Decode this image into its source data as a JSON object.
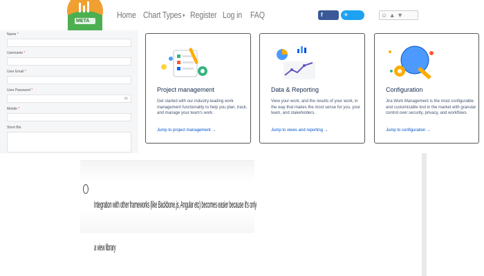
{
  "navbar": {
    "logo_text": "META",
    "links": [
      {
        "label": "Home"
      },
      {
        "label": "Chart Types"
      },
      {
        "label": "Register"
      },
      {
        "label": "Log in"
      },
      {
        "label": "FAQ"
      }
    ],
    "share_facebook": "Share",
    "share_twitter": "Tweet"
  },
  "form": {
    "fields": [
      {
        "label": "Name",
        "required": "*"
      },
      {
        "label": "Username",
        "required": "*"
      },
      {
        "label": "User Email",
        "required": "*"
      },
      {
        "label": "User Password",
        "required": "*",
        "suffix": "ab"
      },
      {
        "label": "Mobile",
        "required": "*"
      },
      {
        "label": "Short Bio",
        "required": ""
      }
    ]
  },
  "cards": [
    {
      "title": "Project management",
      "description": "Get started with our industry-leading work management functionality to help you plan, track, and manage your team's work.",
      "link": "Jump to project management →"
    },
    {
      "title": "Data & Reporting",
      "description": "View your work, and the results of your work, in the way that makes the most sense for you, your team, and stakeholders.",
      "link": "Jump to views and reporting →"
    },
    {
      "title": "Configuration",
      "description": "Jira Work Management is the most configurable and customizable tool in the market with granular control over security, privacy, and workflows.",
      "link": "Jump to configuration →"
    }
  ],
  "fragment": {
    "text": "Integration with other frameworks (like Backbone.js, Angular etc) becomes easier because it's only a view library"
  },
  "colors": {
    "facebook": "#3b5998",
    "twitter": "#1da1f2",
    "link": "#0052cc",
    "title": "#172b4d"
  }
}
